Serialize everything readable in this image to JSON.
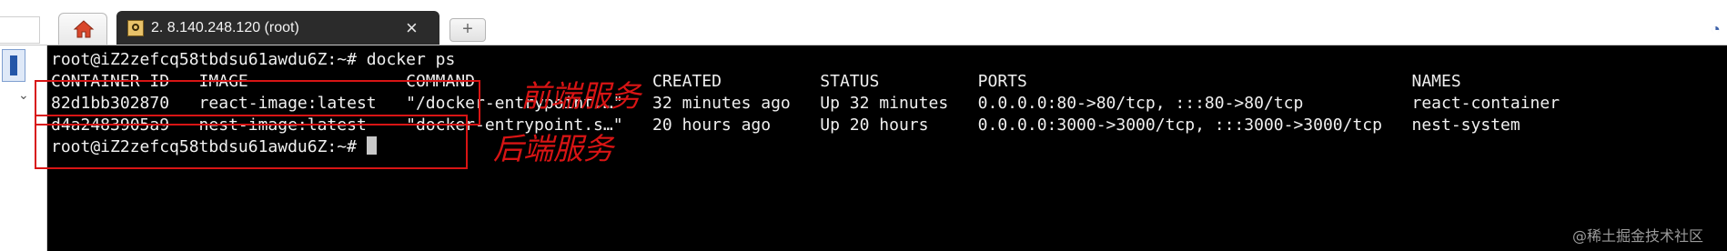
{
  "tabs": {
    "home_icon": "home-icon",
    "session": {
      "label": "2. 8.140.248.120 (root)",
      "close": "×",
      "icon": "session-key-icon"
    },
    "new_tab": "+"
  },
  "terminal": {
    "lines": [
      "root@iZ2zefcq58tbdsu61awdu6Z:~# docker ps",
      "CONTAINER ID   IMAGE                COMMAND                  CREATED          STATUS          PORTS                                       NAMES",
      "82d1bb302870   react-image:latest   \"/docker-entrypoint.…\"   32 minutes ago   Up 32 minutes   0.0.0.0:80->80/tcp, :::80->80/tcp           react-container",
      "d4a2483905a9   nest-image:latest    \"docker-entrypoint.s…\"   20 hours ago     Up 20 hours     0.0.0.0:3000->3000/tcp, :::3000->3000/tcp   nest-system",
      "root@iZ2zefcq58tbdsu61awdu6Z:~# "
    ]
  },
  "annotations": {
    "frontend": "前端服务",
    "backend": "后端服务",
    "color": "#d81414"
  },
  "watermark": "@稀土掘金技术社区"
}
